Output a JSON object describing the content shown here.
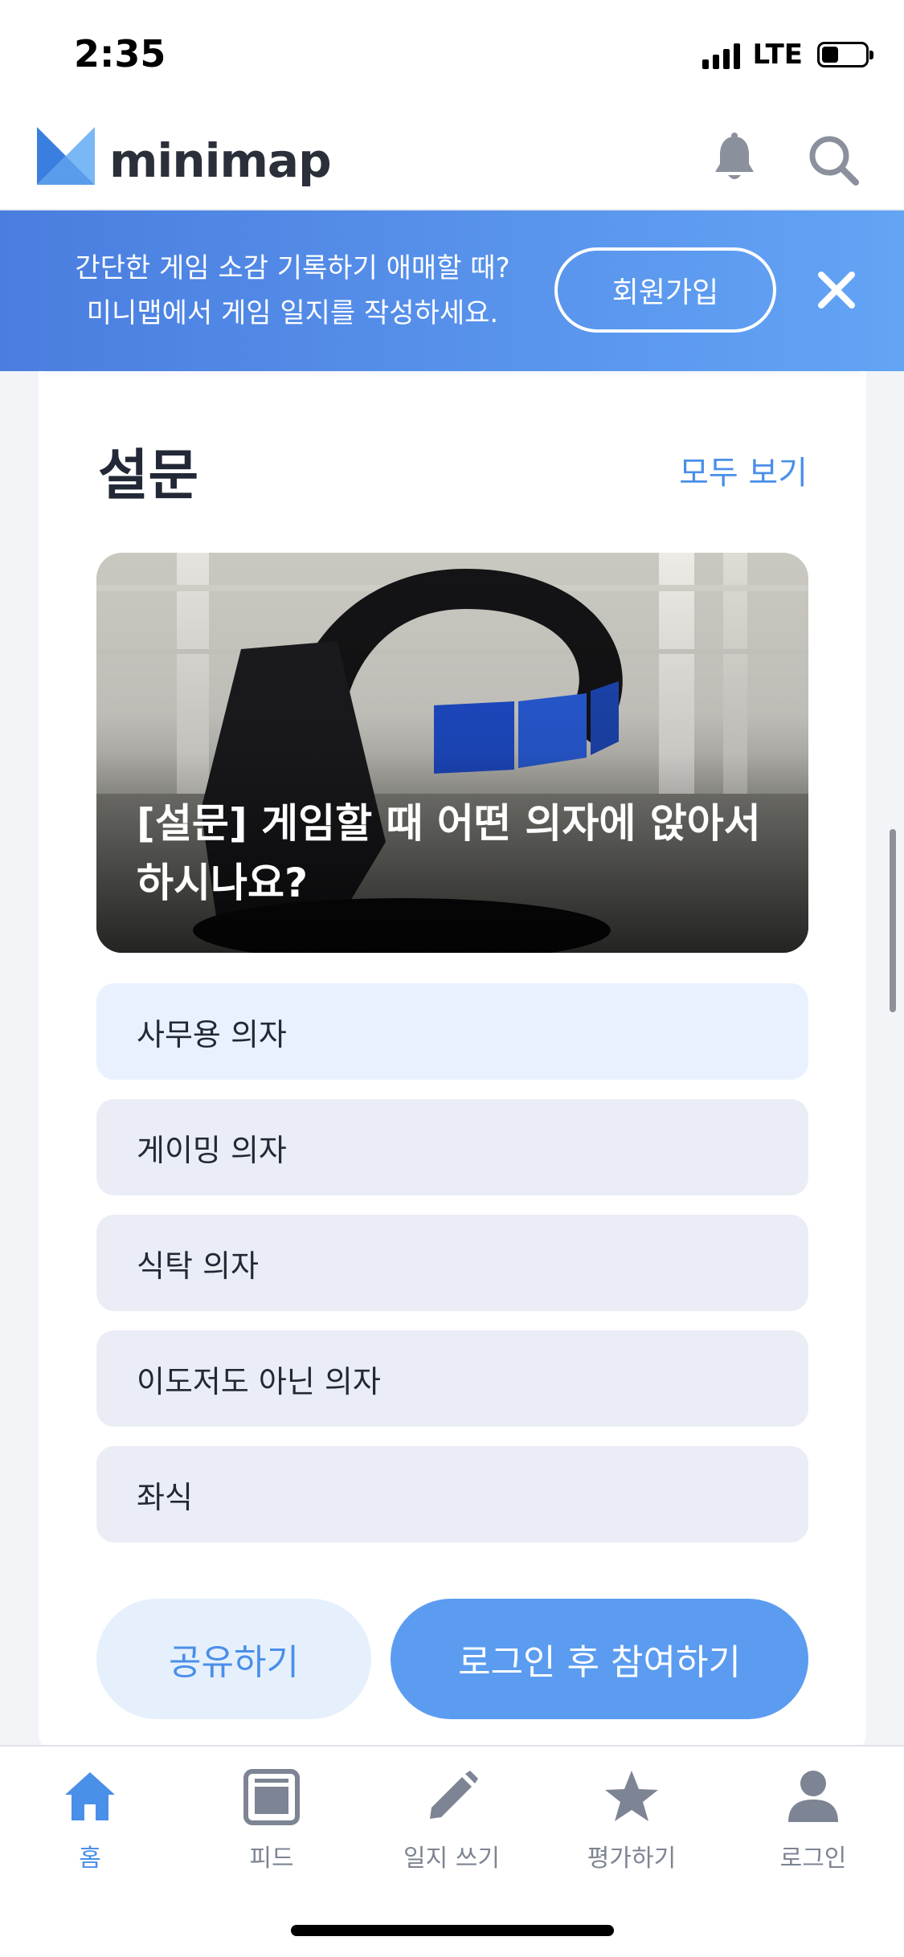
{
  "status_bar": {
    "time": "2:35",
    "network": "LTE"
  },
  "header": {
    "logo_text": "minimap",
    "icons": [
      "bell-icon",
      "search-icon"
    ]
  },
  "banner": {
    "line1": "간단한 게임 소감 기록하기 애매할 때?",
    "line2": "미니맵에서 게임 일지를 작성하세요.",
    "signup_label": "회원가입"
  },
  "survey": {
    "section_title": "설문",
    "see_all_label": "모두 보기",
    "question": "[설문] 게임할 때 어떤 의자에 앉아서 하시나요?",
    "options": [
      "사무용 의자",
      "게이밍 의자",
      "식탁 의자",
      "이도저도 아닌 의자",
      "좌식"
    ],
    "share_label": "공유하기",
    "join_label": "로그인 후 참여하기"
  },
  "tab_bar": {
    "items": [
      {
        "label": "홈",
        "icon": "home-icon",
        "active": true
      },
      {
        "label": "피드",
        "icon": "feed-icon",
        "active": false
      },
      {
        "label": "일지 쓰기",
        "icon": "pencil-icon",
        "active": false
      },
      {
        "label": "평가하기",
        "icon": "star-icon",
        "active": false
      },
      {
        "label": "로그인",
        "icon": "user-icon",
        "active": false
      }
    ]
  },
  "colors": {
    "accent": "#4a8fe8",
    "banner_start": "#4a7ddf",
    "banner_end": "#63a4f5",
    "option_bg": "#eaedf5",
    "primary_button": "#5b9cf0"
  }
}
